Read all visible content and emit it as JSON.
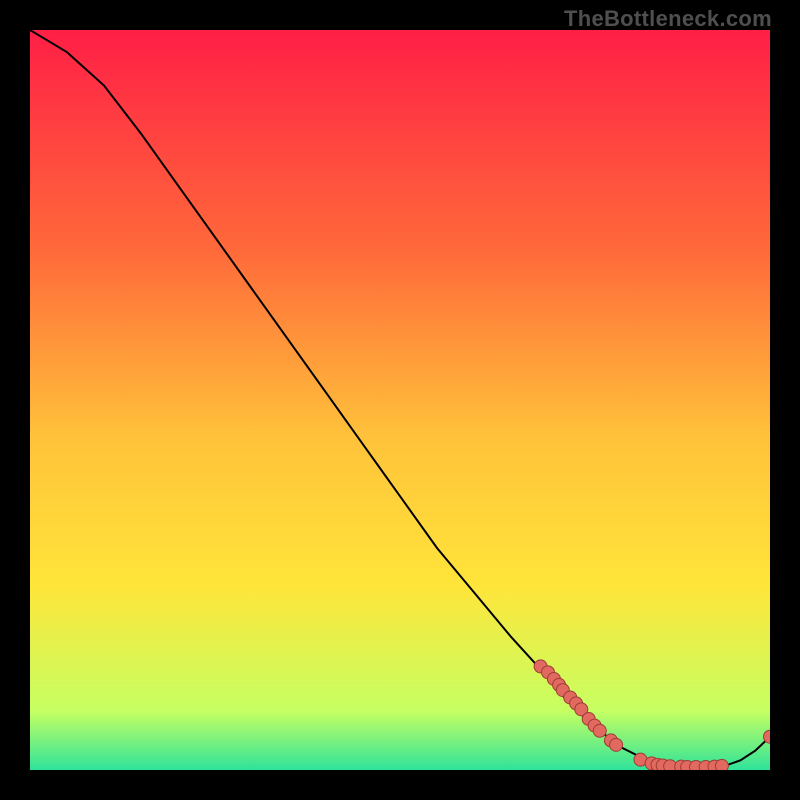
{
  "watermark": "TheBottleneck.com",
  "colors": {
    "gradient_top": "#ff1f46",
    "gradient_mid1": "#ff6a3a",
    "gradient_mid2": "#ffc23a",
    "gradient_mid3": "#ffe53a",
    "gradient_bottom1": "#c6ff62",
    "gradient_bottom2": "#2fe39a",
    "curve_stroke": "#000000",
    "dot_fill": "#e2695f",
    "dot_stroke": "#9e3d36"
  },
  "chart_data": {
    "type": "line",
    "title": "",
    "xlabel": "",
    "ylabel": "",
    "xlim": [
      0,
      100
    ],
    "ylim": [
      0,
      100
    ],
    "series": [
      {
        "name": "curve",
        "x": [
          0,
          5,
          10,
          15,
          20,
          25,
          30,
          35,
          40,
          45,
          50,
          55,
          60,
          65,
          70,
          72,
          75,
          78,
          80,
          82,
          84,
          86,
          88,
          90,
          92,
          94,
          96,
          98,
          100
        ],
        "values": [
          100,
          97,
          92.5,
          86,
          79,
          72,
          65,
          58,
          51,
          44,
          37,
          30,
          24,
          18,
          12.5,
          10,
          7,
          4.5,
          3,
          2,
          1.3,
          0.8,
          0.5,
          0.4,
          0.4,
          0.6,
          1.3,
          2.6,
          4.5
        ]
      }
    ],
    "dots": [
      {
        "x": 69,
        "y": 14
      },
      {
        "x": 70,
        "y": 13.2
      },
      {
        "x": 70.8,
        "y": 12.3
      },
      {
        "x": 71.5,
        "y": 11.5
      },
      {
        "x": 72,
        "y": 10.8
      },
      {
        "x": 73,
        "y": 9.8
      },
      {
        "x": 73.8,
        "y": 9
      },
      {
        "x": 74.5,
        "y": 8.2
      },
      {
        "x": 75.5,
        "y": 6.9
      },
      {
        "x": 76.3,
        "y": 6
      },
      {
        "x": 77,
        "y": 5.3
      },
      {
        "x": 78.5,
        "y": 4
      },
      {
        "x": 79.2,
        "y": 3.4
      },
      {
        "x": 82.5,
        "y": 1.4
      },
      {
        "x": 84,
        "y": 0.9
      },
      {
        "x": 84.8,
        "y": 0.7
      },
      {
        "x": 85.5,
        "y": 0.6
      },
      {
        "x": 86.5,
        "y": 0.5
      },
      {
        "x": 88,
        "y": 0.45
      },
      {
        "x": 88.8,
        "y": 0.4
      },
      {
        "x": 90,
        "y": 0.4
      },
      {
        "x": 91.3,
        "y": 0.4
      },
      {
        "x": 92.5,
        "y": 0.45
      },
      {
        "x": 93.5,
        "y": 0.55
      },
      {
        "x": 100,
        "y": 4.5
      }
    ]
  }
}
